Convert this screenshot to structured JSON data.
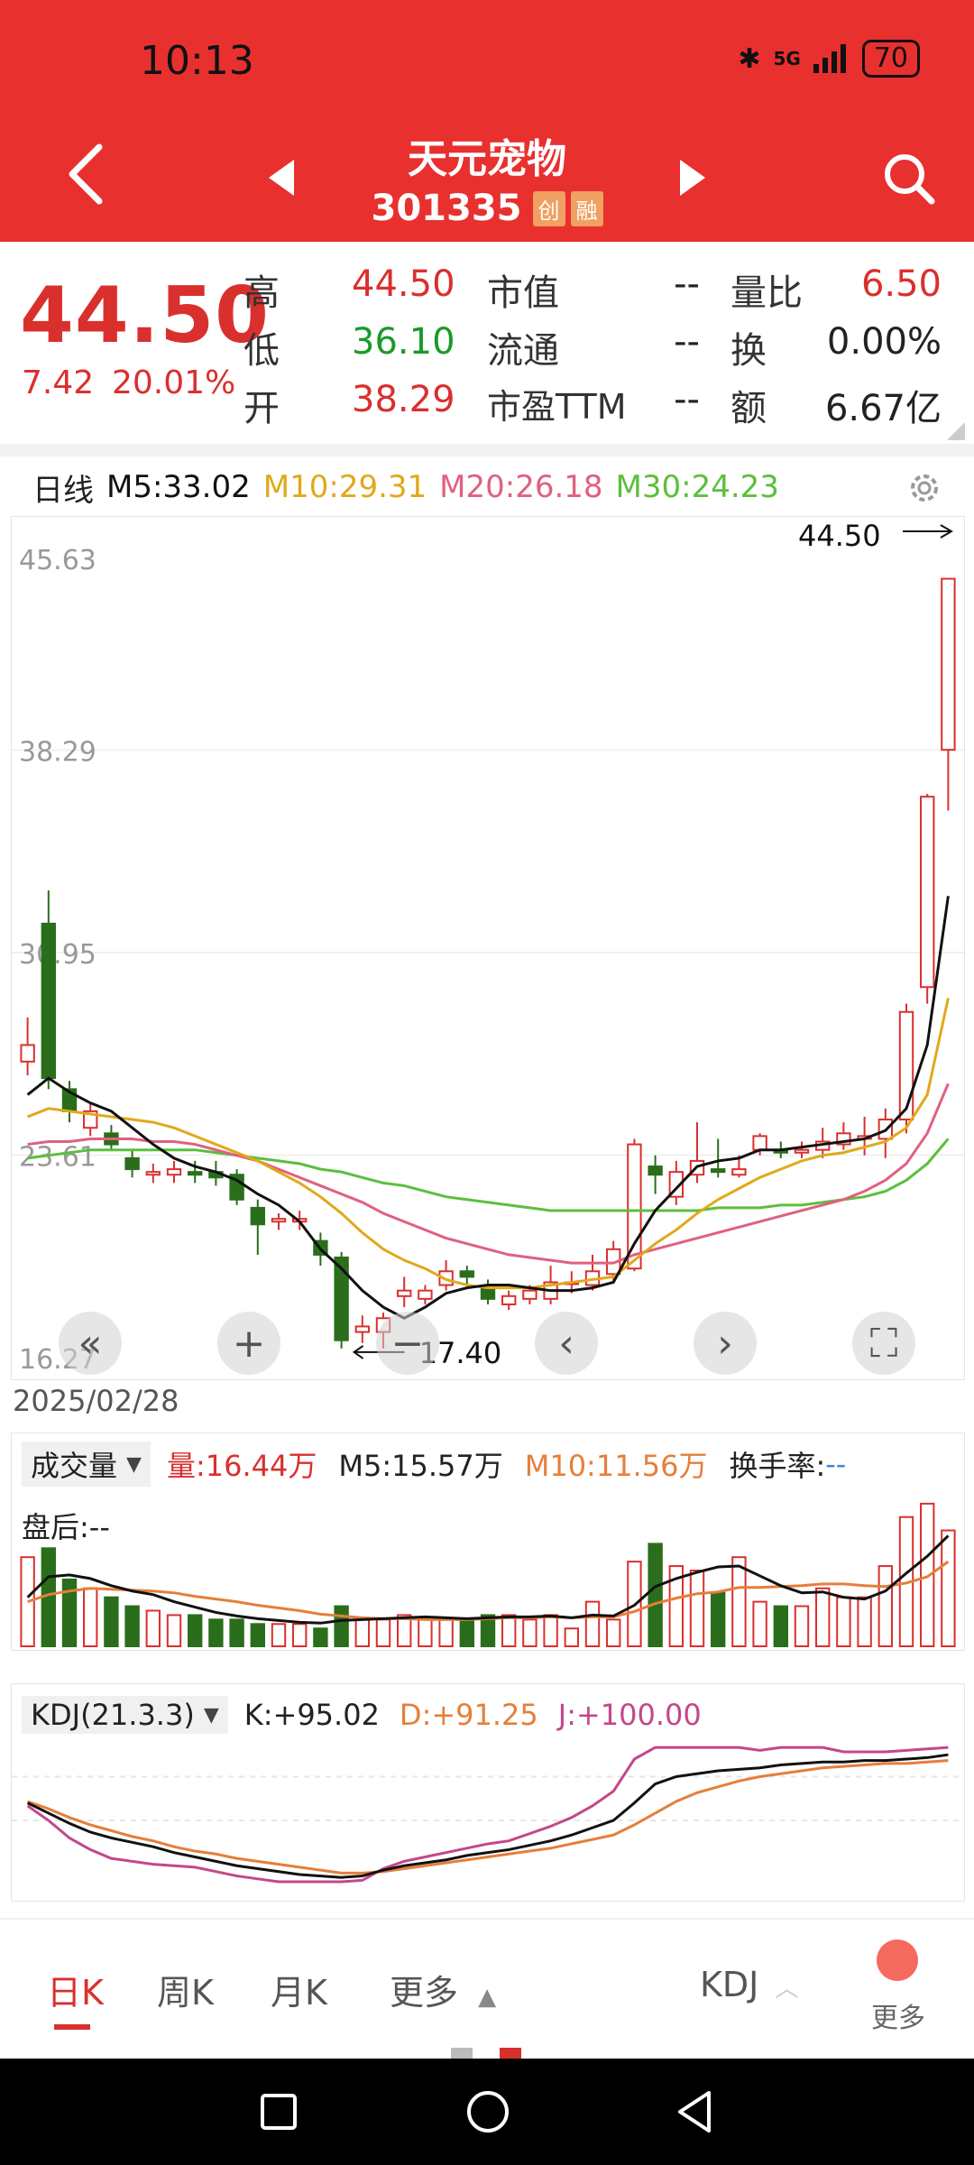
{
  "status": {
    "time": "10:13",
    "battery": "70",
    "signal": "5G"
  },
  "header": {
    "title": "天元宠物",
    "code": "301335",
    "tag1": "创",
    "tag2": "融"
  },
  "quote": {
    "price": "44.50",
    "change": "7.42",
    "change_pct": "20.01%",
    "rows": [
      {
        "l1": "高",
        "v1": "44.50",
        "c1": "red",
        "l2": "市值",
        "v2": "--",
        "l3": "量比",
        "v3": "6.50",
        "c3": "red"
      },
      {
        "l1": "低",
        "v1": "36.10",
        "c1": "green",
        "l2": "流通",
        "v2": "--",
        "l3": "换",
        "v3": "0.00%",
        "c3": "dark"
      },
      {
        "l1": "开",
        "v1": "38.29",
        "c1": "red",
        "l2": "市盈TTM",
        "v2": "--",
        "l3": "额",
        "v3": "6.67亿",
        "c3": "dark"
      }
    ]
  },
  "ma": {
    "period": "日线",
    "m5": "M5:33.02",
    "m10": "M10:29.31",
    "m20": "M20:26.18",
    "m30": "M30:24.23"
  },
  "colors": {
    "red": "#d9302e",
    "green": "#2a6e1b",
    "m5": "#111111",
    "m10": "#e0a91b",
    "m20": "#e06080",
    "m30": "#5bbf3c",
    "kdj_d": "#e67e3a",
    "kdj_j": "#c4478a"
  },
  "axis": {
    "y_labels": [
      "45.63",
      "38.29",
      "30.95",
      "23.61",
      "16.27"
    ],
    "high_label": "44.50",
    "low_label": "17.40"
  },
  "date": "2025/02/28",
  "volume": {
    "label": "成交量",
    "vol": "量:16.44万",
    "m5": "M5:15.57万",
    "m10": "M10:11.56万",
    "turnover_label": "换手率:",
    "turnover_value": "--",
    "after_hours": "盘后:--"
  },
  "kdj": {
    "label": "KDJ(21.3.3)",
    "k": "K:+95.02",
    "d": "D:+91.25",
    "j": "J:+100.00"
  },
  "tabs": {
    "day": "日K",
    "week": "周K",
    "month": "月K",
    "more": "更多",
    "indicator": "KDJ",
    "more2": "更多"
  },
  "chart_data": {
    "type": "candlestick",
    "ylim": [
      16.27,
      45.63
    ],
    "y_ticks": [
      45.63,
      38.29,
      30.95,
      23.61,
      16.27
    ],
    "candles": [
      {
        "o": 27.0,
        "c": 27.6,
        "h": 28.6,
        "l": 26.5
      },
      {
        "o": 32.0,
        "c": 26.4,
        "h": 33.2,
        "l": 26.0
      },
      {
        "o": 26.0,
        "c": 25.2,
        "h": 26.3,
        "l": 24.8
      },
      {
        "o": 24.6,
        "c": 25.2,
        "h": 25.5,
        "l": 24.3
      },
      {
        "o": 24.4,
        "c": 24.0,
        "h": 24.7,
        "l": 23.8
      },
      {
        "o": 23.5,
        "c": 23.1,
        "h": 23.8,
        "l": 22.8
      },
      {
        "o": 22.9,
        "c": 23.0,
        "h": 23.3,
        "l": 22.6
      },
      {
        "o": 22.9,
        "c": 23.1,
        "h": 23.4,
        "l": 22.6
      },
      {
        "o": 23.0,
        "c": 22.9,
        "h": 23.4,
        "l": 22.6
      },
      {
        "o": 23.0,
        "c": 22.8,
        "h": 23.4,
        "l": 22.5
      },
      {
        "o": 22.9,
        "c": 22.0,
        "h": 23.1,
        "l": 21.8
      },
      {
        "o": 21.7,
        "c": 21.1,
        "h": 22.0,
        "l": 20.0
      },
      {
        "o": 21.2,
        "c": 21.3,
        "h": 21.5,
        "l": 20.9
      },
      {
        "o": 21.2,
        "c": 21.3,
        "h": 21.6,
        "l": 20.9
      },
      {
        "o": 20.5,
        "c": 20.0,
        "h": 20.8,
        "l": 19.6
      },
      {
        "o": 19.9,
        "c": 16.9,
        "h": 20.1,
        "l": 16.6
      },
      {
        "o": 17.2,
        "c": 17.4,
        "h": 17.8,
        "l": 16.8
      },
      {
        "o": 17.2,
        "c": 17.7,
        "h": 17.9,
        "l": 16.6
      },
      {
        "o": 18.5,
        "c": 18.7,
        "h": 19.2,
        "l": 18.1
      },
      {
        "o": 18.4,
        "c": 18.7,
        "h": 18.9,
        "l": 18.2
      },
      {
        "o": 18.9,
        "c": 19.4,
        "h": 19.8,
        "l": 18.7
      },
      {
        "o": 19.4,
        "c": 19.2,
        "h": 19.6,
        "l": 18.9
      },
      {
        "o": 18.8,
        "c": 18.4,
        "h": 19.1,
        "l": 18.2
      },
      {
        "o": 18.2,
        "c": 18.5,
        "h": 18.7,
        "l": 18.0
      },
      {
        "o": 18.4,
        "c": 18.7,
        "h": 18.9,
        "l": 18.2
      },
      {
        "o": 18.4,
        "c": 19.0,
        "h": 19.6,
        "l": 18.2
      },
      {
        "o": 19.0,
        "c": 19.0,
        "h": 19.4,
        "l": 18.6
      },
      {
        "o": 18.9,
        "c": 19.4,
        "h": 20.0,
        "l": 18.7
      },
      {
        "o": 19.3,
        "c": 20.2,
        "h": 20.5,
        "l": 19.0
      },
      {
        "o": 19.5,
        "c": 24.0,
        "h": 24.2,
        "l": 19.4
      },
      {
        "o": 23.2,
        "c": 22.9,
        "h": 23.6,
        "l": 22.2
      },
      {
        "o": 22.1,
        "c": 23.0,
        "h": 23.4,
        "l": 21.8
      },
      {
        "o": 22.9,
        "c": 23.4,
        "h": 24.8,
        "l": 22.6
      },
      {
        "o": 23.1,
        "c": 23.0,
        "h": 24.2,
        "l": 22.8
      },
      {
        "o": 22.9,
        "c": 23.1,
        "h": 23.6,
        "l": 22.8
      },
      {
        "o": 23.8,
        "c": 24.3,
        "h": 24.4,
        "l": 23.6
      },
      {
        "o": 23.8,
        "c": 23.7,
        "h": 24.1,
        "l": 23.5
      },
      {
        "o": 23.7,
        "c": 23.8,
        "h": 24.1,
        "l": 23.5
      },
      {
        "o": 23.8,
        "c": 24.1,
        "h": 24.6,
        "l": 23.5
      },
      {
        "o": 24.0,
        "c": 24.4,
        "h": 24.8,
        "l": 23.8
      },
      {
        "o": 24.2,
        "c": 24.3,
        "h": 25.0,
        "l": 23.6
      },
      {
        "o": 24.2,
        "c": 24.9,
        "h": 25.3,
        "l": 23.5
      },
      {
        "o": 24.9,
        "c": 28.8,
        "h": 29.1,
        "l": 24.4
      },
      {
        "o": 29.7,
        "c": 36.6,
        "h": 36.7,
        "l": 29.1
      },
      {
        "o": 38.3,
        "c": 44.5,
        "h": 44.5,
        "l": 36.1
      }
    ],
    "ma5": [
      25.8,
      26.4,
      25.9,
      25.5,
      25.2,
      24.6,
      24.0,
      23.5,
      23.2,
      23.0,
      22.7,
      22.2,
      21.8,
      21.2,
      20.2,
      19.5,
      18.7,
      18.1,
      17.7,
      18.1,
      18.6,
      18.8,
      18.9,
      18.9,
      18.8,
      18.7,
      18.7,
      18.8,
      19.0,
      20.4,
      21.6,
      22.4,
      23.2,
      23.4,
      23.5,
      23.8,
      23.8,
      23.9,
      24.0,
      24.1,
      24.2,
      24.5,
      25.3,
      27.6,
      33.0
    ],
    "ma10": [
      25.0,
      25.3,
      25.2,
      25.1,
      25.0,
      24.9,
      24.8,
      24.6,
      24.3,
      24.0,
      23.7,
      23.4,
      23.0,
      22.6,
      22.1,
      21.5,
      20.8,
      20.2,
      19.8,
      19.5,
      19.1,
      18.9,
      18.8,
      18.8,
      18.8,
      18.9,
      19.0,
      19.1,
      19.2,
      19.8,
      20.4,
      20.9,
      21.5,
      22.0,
      22.4,
      22.8,
      23.1,
      23.4,
      23.6,
      23.7,
      23.9,
      24.1,
      24.6,
      25.8,
      29.3
    ],
    "ma20": [
      24.0,
      24.1,
      24.1,
      24.2,
      24.2,
      24.2,
      24.1,
      24.1,
      24.0,
      23.8,
      23.6,
      23.4,
      23.1,
      22.8,
      22.5,
      22.2,
      21.9,
      21.5,
      21.2,
      20.9,
      20.6,
      20.4,
      20.2,
      20.0,
      19.9,
      19.8,
      19.7,
      19.7,
      19.7,
      20.0,
      20.2,
      20.4,
      20.6,
      20.8,
      21.0,
      21.2,
      21.4,
      21.6,
      21.8,
      22.0,
      22.3,
      22.7,
      23.3,
      24.4,
      26.2
    ],
    "ma30": [
      23.5,
      23.6,
      23.7,
      23.8,
      23.8,
      23.8,
      23.8,
      23.8,
      23.8,
      23.7,
      23.6,
      23.5,
      23.4,
      23.3,
      23.1,
      23.0,
      22.8,
      22.6,
      22.5,
      22.3,
      22.1,
      22.0,
      21.9,
      21.8,
      21.7,
      21.6,
      21.6,
      21.6,
      21.6,
      21.6,
      21.6,
      21.6,
      21.6,
      21.7,
      21.7,
      21.7,
      21.8,
      21.8,
      21.9,
      22.0,
      22.1,
      22.3,
      22.7,
      23.3,
      24.2
    ],
    "volume": [
      10.0,
      11.0,
      7.5,
      6.5,
      5.5,
      4.5,
      4.0,
      3.5,
      3.5,
      3.0,
      3.0,
      2.5,
      2.5,
      2.5,
      2.0,
      4.5,
      3.0,
      3.0,
      3.5,
      3.0,
      3.0,
      3.0,
      3.5,
      3.5,
      3.0,
      3.5,
      2.0,
      5.0,
      3.0,
      9.5,
      11.5,
      9.0,
      8.5,
      6.0,
      10.0,
      5.0,
      4.5,
      4.5,
      6.5,
      5.5,
      5.5,
      9.0,
      14.5,
      16.0,
      13.0
    ],
    "vol_m5": [
      5.5,
      7.8,
      8.0,
      7.6,
      6.8,
      6.2,
      5.8,
      5.0,
      4.4,
      3.8,
      3.4,
      3.1,
      2.9,
      2.7,
      2.6,
      2.9,
      3.0,
      3.1,
      3.2,
      3.3,
      3.2,
      3.1,
      3.2,
      3.3,
      3.3,
      3.4,
      3.2,
      3.5,
      3.4,
      4.6,
      6.7,
      7.6,
      8.3,
      8.9,
      9.0,
      7.9,
      6.8,
      6.0,
      6.1,
      5.5,
      5.3,
      6.2,
      8.2,
      10.1,
      12.4
    ],
    "vol_m10": [
      5.0,
      5.8,
      6.2,
      6.5,
      6.4,
      6.3,
      6.2,
      6.0,
      5.6,
      5.3,
      5.0,
      4.6,
      4.3,
      4.0,
      3.6,
      3.4,
      3.2,
      3.1,
      3.1,
      3.0,
      3.0,
      3.0,
      3.1,
      3.2,
      3.2,
      3.3,
      3.2,
      3.3,
      3.3,
      3.9,
      4.8,
      5.4,
      5.9,
      6.1,
      6.6,
      6.6,
      6.7,
      6.8,
      7.0,
      7.0,
      6.8,
      6.7,
      7.1,
      7.8,
      9.5
    ],
    "vol_ylim": [
      0,
      17
    ],
    "kdj_ylim": [
      0,
      105
    ],
    "k": [
      62,
      55,
      48,
      42,
      38,
      35,
      32,
      28,
      25,
      22,
      19,
      17,
      15,
      13,
      12,
      11,
      12,
      16,
      19,
      21,
      23,
      26,
      28,
      30,
      33,
      36,
      40,
      45,
      50,
      62,
      75,
      80,
      82,
      84,
      85,
      86,
      88,
      89,
      90,
      90,
      91,
      91,
      92,
      93,
      95
    ],
    "d": [
      63,
      58,
      52,
      47,
      43,
      39,
      36,
      32,
      29,
      27,
      24,
      22,
      20,
      18,
      16,
      14,
      14,
      15,
      17,
      19,
      21,
      23,
      25,
      27,
      29,
      31,
      34,
      37,
      40,
      47,
      55,
      63,
      69,
      73,
      77,
      80,
      82,
      84,
      86,
      87,
      88,
      89,
      89,
      90,
      91
    ],
    "j": [
      60,
      50,
      38,
      30,
      24,
      22,
      20,
      19,
      18,
      15,
      12,
      10,
      8,
      8,
      8,
      8,
      9,
      17,
      22,
      25,
      28,
      31,
      34,
      36,
      41,
      46,
      52,
      60,
      70,
      92,
      100,
      100,
      100,
      100,
      100,
      98,
      100,
      100,
      100,
      97,
      97,
      97,
      98,
      99,
      100
    ]
  }
}
